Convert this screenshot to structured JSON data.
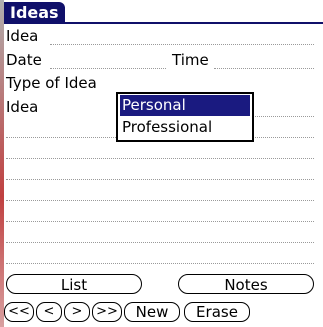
{
  "app": {
    "title": "Ideas"
  },
  "form": {
    "idea_label": "Idea",
    "date_label": "Date",
    "time_label": "Time",
    "type_label": "Type of Idea",
    "idea2_label": "Idea"
  },
  "type_popup": {
    "options": [
      "Personal",
      "Professional"
    ],
    "selected": "Personal"
  },
  "buttons": {
    "list": "List",
    "notes": "Notes",
    "first": "<<",
    "prev": "<",
    "next": ">",
    "last": ">>",
    "new": "New",
    "erase": "Erase"
  },
  "colors": {
    "title_bg": "#10106a",
    "selection_bg": "#1a1a80"
  }
}
